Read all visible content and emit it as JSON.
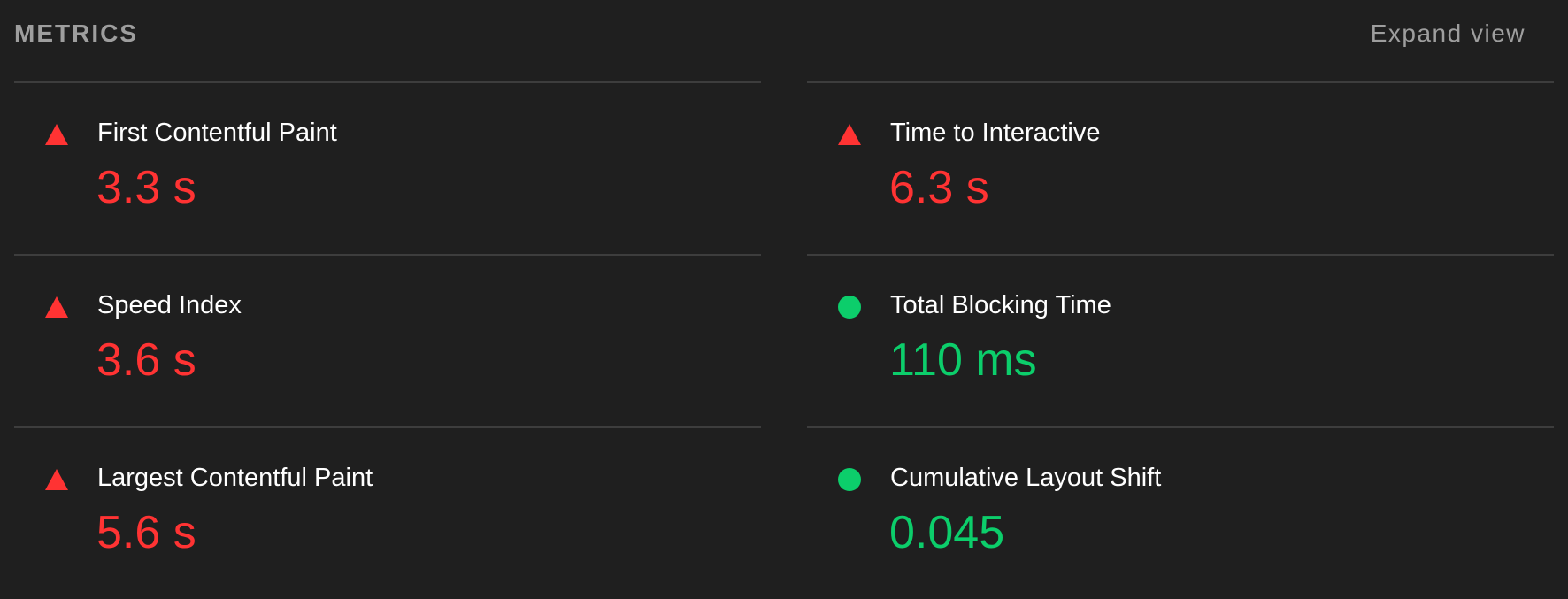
{
  "header": {
    "title": "METRICS",
    "expand_label": "Expand view"
  },
  "colors": {
    "fail": "#ff3333",
    "pass": "#0cce6b",
    "background": "#1f1f1f",
    "muted": "#9e9e9e",
    "divider": "#3d3d3d"
  },
  "metrics": [
    {
      "label": "First Contentful Paint",
      "value": "3.3 s",
      "status": "fail",
      "icon": "fail-triangle-icon"
    },
    {
      "label": "Time to Interactive",
      "value": "6.3 s",
      "status": "fail",
      "icon": "fail-triangle-icon"
    },
    {
      "label": "Speed Index",
      "value": "3.6 s",
      "status": "fail",
      "icon": "fail-triangle-icon"
    },
    {
      "label": "Total Blocking Time",
      "value": "110 ms",
      "status": "pass",
      "icon": "pass-circle-icon"
    },
    {
      "label": "Largest Contentful Paint",
      "value": "5.6 s",
      "status": "fail",
      "icon": "fail-triangle-icon"
    },
    {
      "label": "Cumulative Layout Shift",
      "value": "0.045",
      "status": "pass",
      "icon": "pass-circle-icon"
    }
  ]
}
